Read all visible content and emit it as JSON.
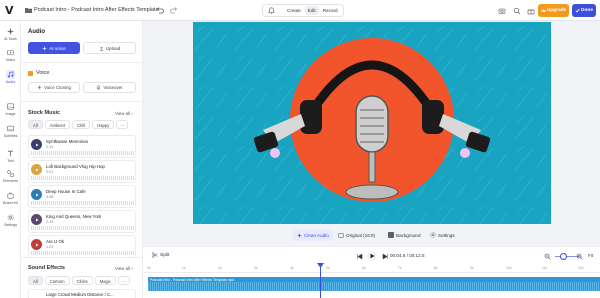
{
  "topbar": {
    "logo": "V",
    "project_name": "Podcast Intro - Podcast Intro After Effects Template",
    "modes": [
      "Create",
      "Edit",
      "Record"
    ],
    "active_mode": "Edit",
    "upgrade_label": "Upgrade",
    "done_label": "Done"
  },
  "rail": {
    "items": [
      {
        "label": "AI Tools",
        "icon": "sparkle-icon"
      },
      {
        "label": "Video",
        "icon": "video-icon"
      },
      {
        "label": "Audio",
        "icon": "music-icon"
      },
      {
        "label": "Image",
        "icon": "image-icon"
      },
      {
        "label": "Subtitles",
        "icon": "subtitles-icon"
      },
      {
        "label": "Text",
        "icon": "text-icon"
      },
      {
        "label": "Elements",
        "icon": "elements-icon"
      },
      {
        "label": "Brand Kit",
        "icon": "brand-kit-icon"
      },
      {
        "label": "Settings",
        "icon": "gear-icon"
      }
    ],
    "active": "Audio"
  },
  "panel": {
    "title": "Audio",
    "ai_voice_label": "AI voice",
    "upload_label": "Upload",
    "voice": {
      "heading": "Voice",
      "cloning_label": "Voice Cloning",
      "voiceover_label": "Voiceover"
    },
    "stock_music": {
      "heading": "Stock Music",
      "view_all": "View all",
      "chips": [
        "All",
        "Ambient",
        "Chill",
        "Happy"
      ],
      "active_chip": "All",
      "tracks": [
        {
          "name": "Synthwave Memories",
          "duration": "2:10",
          "color": "#3a3f6b"
        },
        {
          "name": "Lofi Background Vlog Hip Hop",
          "duration": "2:01",
          "color": "#d9a441"
        },
        {
          "name": "Deep House In Cafe",
          "duration": "4:48",
          "color": "#2b7fb8"
        },
        {
          "name": "King And Queens, New York",
          "duration": "2:15",
          "color": "#5a4a6b"
        },
        {
          "name": "Are U Ok",
          "duration": "1:29",
          "color": "#c23c3c"
        }
      ]
    },
    "sound_effects": {
      "heading": "Sound Effects",
      "view_all": "View all",
      "chips": [
        "All",
        "Cartoon",
        "Clicks",
        "Magic"
      ],
      "active_chip": "All",
      "first_item": "Large Crowd Medium Distance / C..."
    }
  },
  "canvas_tools": {
    "clean_audio": "Clean Audio",
    "original": "Original (16:9)",
    "background": "Background",
    "settings": "Settings"
  },
  "timeline": {
    "split_label": "Split",
    "current_time": "00:04.6",
    "separator": "/",
    "total_time": "00:12.5",
    "fit_label": "Fit",
    "ticks": [
      "0s",
      "1s",
      "2s",
      "3s",
      "4s",
      "5s",
      "6s",
      "7s",
      "8s",
      "9s",
      "10s",
      "11s",
      "12s"
    ],
    "clip_label": "Podcast Intro - Podcast Intro After Effects Template.mp4"
  },
  "colors": {
    "accent": "#3e4fd8",
    "upgrade": "#f39a1c",
    "canvas_bg": "#19a5c2",
    "circle": "#f2552c",
    "clip": "#2c98d6"
  }
}
